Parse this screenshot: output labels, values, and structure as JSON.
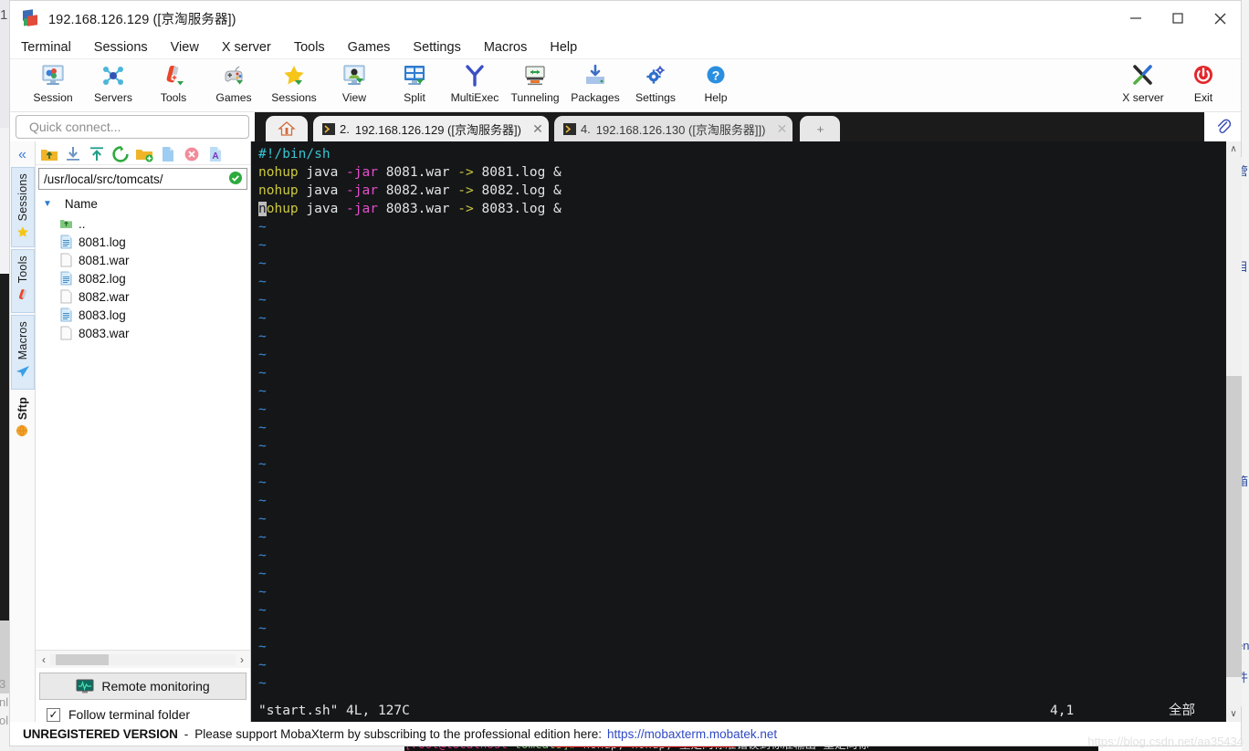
{
  "window": {
    "title": "192.168.126.129 ([京淘服务器])",
    "app_icon": "mobaxterm-icon",
    "controls": {
      "minimize": "minimize-icon",
      "maximize": "maximize-icon",
      "close": "close-icon"
    }
  },
  "menubar": {
    "items": [
      "Terminal",
      "Sessions",
      "View",
      "X server",
      "Tools",
      "Games",
      "Settings",
      "Macros",
      "Help"
    ]
  },
  "toolbar": {
    "items": [
      {
        "label": "Session",
        "icon": "session-icon"
      },
      {
        "label": "Servers",
        "icon": "servers-icon"
      },
      {
        "label": "Tools",
        "icon": "tools-icon"
      },
      {
        "label": "Games",
        "icon": "games-icon"
      },
      {
        "label": "Sessions",
        "icon": "sessions-star-icon"
      },
      {
        "label": "View",
        "icon": "view-icon"
      },
      {
        "label": "Split",
        "icon": "split-icon"
      },
      {
        "label": "MultiExec",
        "icon": "multiexec-icon"
      },
      {
        "label": "Tunneling",
        "icon": "tunneling-icon"
      },
      {
        "label": "Packages",
        "icon": "packages-icon"
      },
      {
        "label": "Settings",
        "icon": "settings-gear-icon"
      },
      {
        "label": "Help",
        "icon": "help-question-icon"
      }
    ],
    "right_items": [
      {
        "label": "X server",
        "icon": "x-server-icon"
      },
      {
        "label": "Exit",
        "icon": "exit-power-icon"
      }
    ]
  },
  "quick_connect": {
    "placeholder": "Quick connect..."
  },
  "tabs": {
    "home_icon": "home-icon",
    "items": [
      {
        "number": "2.",
        "title": "192.168.126.129 ([京淘服务器])",
        "active": true,
        "close": "✕"
      },
      {
        "number": "4.",
        "title": "192.168.126.130 ([京淘服务器]])",
        "active": false,
        "close": "✕"
      }
    ],
    "new_tab": "+",
    "attach_icon": "paperclip-icon"
  },
  "sidebar_strip": {
    "collapse_icon": "chevron-double-left-icon",
    "tabs": [
      {
        "label": "Sessions",
        "icon": "star-icon"
      },
      {
        "label": "Tools",
        "icon": "swissknife-icon"
      },
      {
        "label": "Macros",
        "icon": "paperplane-icon"
      },
      {
        "label": "Sftp",
        "icon": "globe-icon"
      }
    ]
  },
  "sftp": {
    "toolbar_icons": [
      "go-up-folder-icon",
      "download-icon",
      "upload-icon",
      "refresh-icon",
      "new-folder-icon",
      "new-file-icon",
      "delete-icon",
      "text-edit-icon"
    ],
    "path": "/usr/local/src/tomcats/",
    "path_status_icon": "check-circle-icon",
    "column_header": "Name",
    "sort_caret": "▼",
    "files": [
      {
        "name": "..",
        "icon": "parent-folder-icon"
      },
      {
        "name": "8081.log",
        "icon": "text-file-icon"
      },
      {
        "name": "8081.war",
        "icon": "blank-file-icon"
      },
      {
        "name": "8082.log",
        "icon": "text-file-icon"
      },
      {
        "name": "8082.war",
        "icon": "blank-file-icon"
      },
      {
        "name": "8083.log",
        "icon": "text-file-icon"
      },
      {
        "name": "8083.war",
        "icon": "blank-file-icon"
      }
    ],
    "hscroll": {
      "left_arrow": "‹",
      "right_arrow": "›"
    },
    "remote_monitoring": {
      "label": "Remote monitoring",
      "icon": "monitor-graph-icon"
    },
    "follow_terminal": {
      "label": "Follow terminal folder",
      "checked": true,
      "check_glyph": "✓"
    }
  },
  "terminal": {
    "lines": [
      {
        "segments": [
          {
            "t": "#!/bin/sh",
            "c": "c-cyan"
          }
        ]
      },
      {
        "segments": [
          {
            "t": "nohup",
            "c": "c-yellow"
          },
          {
            "t": " java ",
            "c": "c-white"
          },
          {
            "t": "-jar",
            "c": "c-magenta"
          },
          {
            "t": " 8081.war ",
            "c": "c-white"
          },
          {
            "t": "->",
            "c": "c-yellow"
          },
          {
            "t": " 8081.log &",
            "c": "c-white"
          }
        ]
      },
      {
        "segments": [
          {
            "t": "nohup",
            "c": "c-yellow"
          },
          {
            "t": " java ",
            "c": "c-white"
          },
          {
            "t": "-jar",
            "c": "c-magenta"
          },
          {
            "t": " 8082.war ",
            "c": "c-white"
          },
          {
            "t": "->",
            "c": "c-yellow"
          },
          {
            "t": " 8082.log &",
            "c": "c-white"
          }
        ]
      },
      {
        "segments": [
          {
            "t": "n",
            "c": "cursor"
          },
          {
            "t": "ohup",
            "c": "c-yellow"
          },
          {
            "t": " java ",
            "c": "c-white"
          },
          {
            "t": "-jar",
            "c": "c-magenta"
          },
          {
            "t": " 8083.war ",
            "c": "c-white"
          },
          {
            "t": "->",
            "c": "c-yellow"
          },
          {
            "t": " 8083.log &",
            "c": "c-white"
          }
        ]
      }
    ],
    "tilde_count": 26,
    "tilde": "~",
    "status": {
      "file": "\"start.sh\" 4L, 127C",
      "position": "4,1",
      "mode": "全部"
    },
    "scrollbar": {
      "up": "∧",
      "down": "∨"
    }
  },
  "footer": {
    "unregistered": "UNREGISTERED VERSION",
    "dash": "-",
    "message": "Please support MobaXterm by subscribing to the professional edition here:",
    "link": "https://mobaxterm.mobatek.net"
  },
  "watermark": "https://blog.csdn.net/aa35434",
  "background": {
    "left_number": "1",
    "left_text_lines": [
      "3",
      "nl",
      "ol"
    ],
    "right_cn": [
      "管",
      "目",
      "箱",
      "en",
      "件"
    ],
    "bottom_terminal": {
      "prompt_user": "[root@localhost",
      "prompt_dir": " tomcats]#",
      "command": " nohup; nohup;",
      "note": " 重定向标准错误到标准输出 重定向标"
    }
  }
}
